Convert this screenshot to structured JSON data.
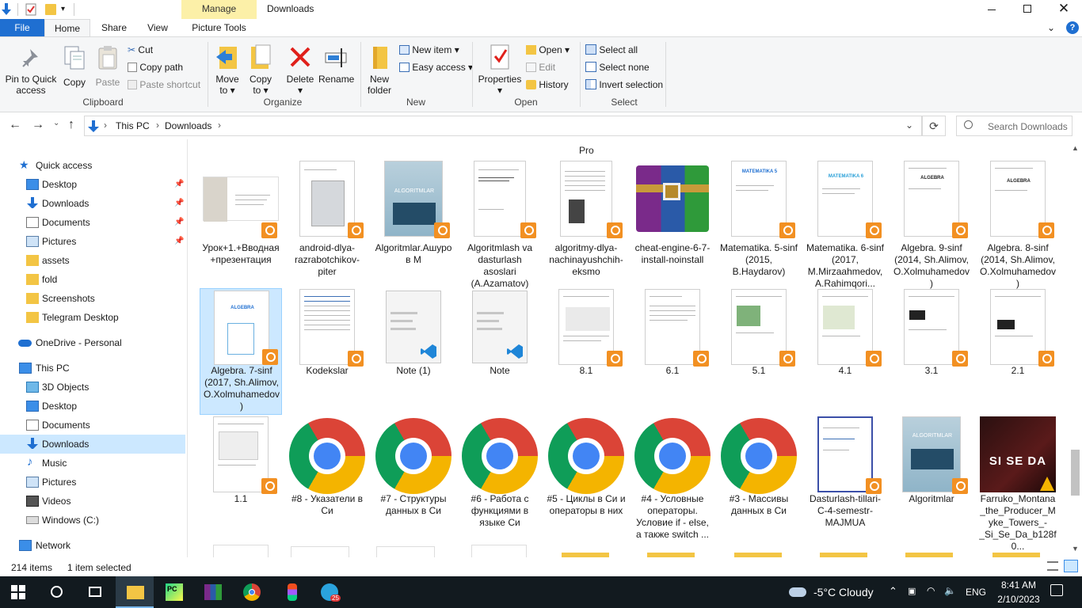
{
  "window": {
    "title": "Downloads",
    "manage_tab": "Manage"
  },
  "tabs": [
    "File",
    "Home",
    "Share",
    "View",
    "Picture Tools"
  ],
  "ribbon": {
    "clipboard": {
      "pin": [
        "Pin to Quick",
        "access"
      ],
      "copy": "Copy",
      "paste": "Paste",
      "cut": "Cut",
      "copy_path": "Copy path",
      "paste_shortcut": "Paste shortcut",
      "group": "Clipboard"
    },
    "organize": {
      "move_to": [
        "Move",
        "to ▾"
      ],
      "copy_to": [
        "Copy",
        "to ▾"
      ],
      "delete": [
        "Delete",
        "▾"
      ],
      "rename": "Rename",
      "group": "Organize"
    },
    "new": {
      "new_folder": [
        "New",
        "folder"
      ],
      "new_item": "New item ▾",
      "easy_access": "Easy access ▾",
      "group": "New"
    },
    "open": {
      "properties": [
        "Properties",
        "▾"
      ],
      "open": "Open ▾",
      "edit": "Edit",
      "history": "History",
      "group": "Open"
    },
    "select": {
      "select_all": "Select all",
      "select_none": "Select none",
      "invert": "Invert selection",
      "group": "Select"
    }
  },
  "address": {
    "crumbs": [
      "This PC",
      "Downloads"
    ],
    "separator": "›",
    "search_placeholder": "Search Downloads"
  },
  "nav": {
    "quick_access": "Quick access",
    "quick_items": [
      "Desktop",
      "Downloads",
      "Documents",
      "Pictures",
      "assets",
      "fold",
      "Screenshots",
      "Telegram Desktop"
    ],
    "onedrive": "OneDrive - Personal",
    "this_pc": "This PC",
    "pc_items": [
      "3D Objects",
      "Desktop",
      "Documents",
      "Downloads",
      "Music",
      "Pictures",
      "Videos",
      "Windows (C:)"
    ],
    "network": "Network"
  },
  "content": {
    "group_header": "Pro",
    "row1": [
      "Урок+1.+Вводная+презентация",
      "android-dlya-razrabotchikov-piter",
      "Algoritmlar.Ашуров М",
      "Algoritmlash va dasturlash asoslari (A.Azamatov)",
      "algoritmy-dlya-nachinayushchih-eksmo",
      "cheat-engine-6-7-install-noinstall",
      "Matematika. 5-sinf (2015, B.Haydarov)",
      "Matematika. 6-sinf (2017, M.Mirzaahmedov, A.Rahimqori...",
      "Algebra. 9-sinf (2014, Sh.Alimov, O.Xolmuhamedov)",
      "Algebra. 8-sinf (2014, Sh.Alimov, O.Xolmuhamedov)"
    ],
    "row2": [
      "Algebra. 7-sinf (2017, Sh.Alimov, O.Xolmuhamedov)",
      "Kodekslar",
      "Note (1)",
      "Note",
      "8.1",
      "6.1",
      "5.1",
      "4.1",
      "3.1",
      "2.1"
    ],
    "row3": [
      "1.1",
      "#8 - Указатели в Си",
      "#7 - Структуры данных в Си",
      "#6 - Работа с функциями в языке Си",
      "#5 - Циклы в Си и операторы в них",
      "#4 - Условные операторы. Условие if - else, а также switch ...",
      "#3 - Массивы данных в Си",
      "Dasturlash-tillari-C-4-semestr-MAJMUA",
      "Algoritmlar",
      "Farruko_Montana_the_Producer_Myke_Towers_-_Si_Se_Da_b128f0..."
    ],
    "thumb_text": {
      "algoritmlar": "ALGORITMLAR",
      "matematika5": "MATEMATIKA 5",
      "matematika6": "MATEMATIKA 6",
      "algebra": "ALGEBRA",
      "album": "SI SE DA"
    }
  },
  "status": {
    "count": "214 items",
    "selected": "1 item selected"
  },
  "taskbar": {
    "weather": "-5°C  Cloudy",
    "lang": "ENG",
    "time": "8:41 AM",
    "date": "2/10/2023",
    "telegram_badge": "25"
  }
}
